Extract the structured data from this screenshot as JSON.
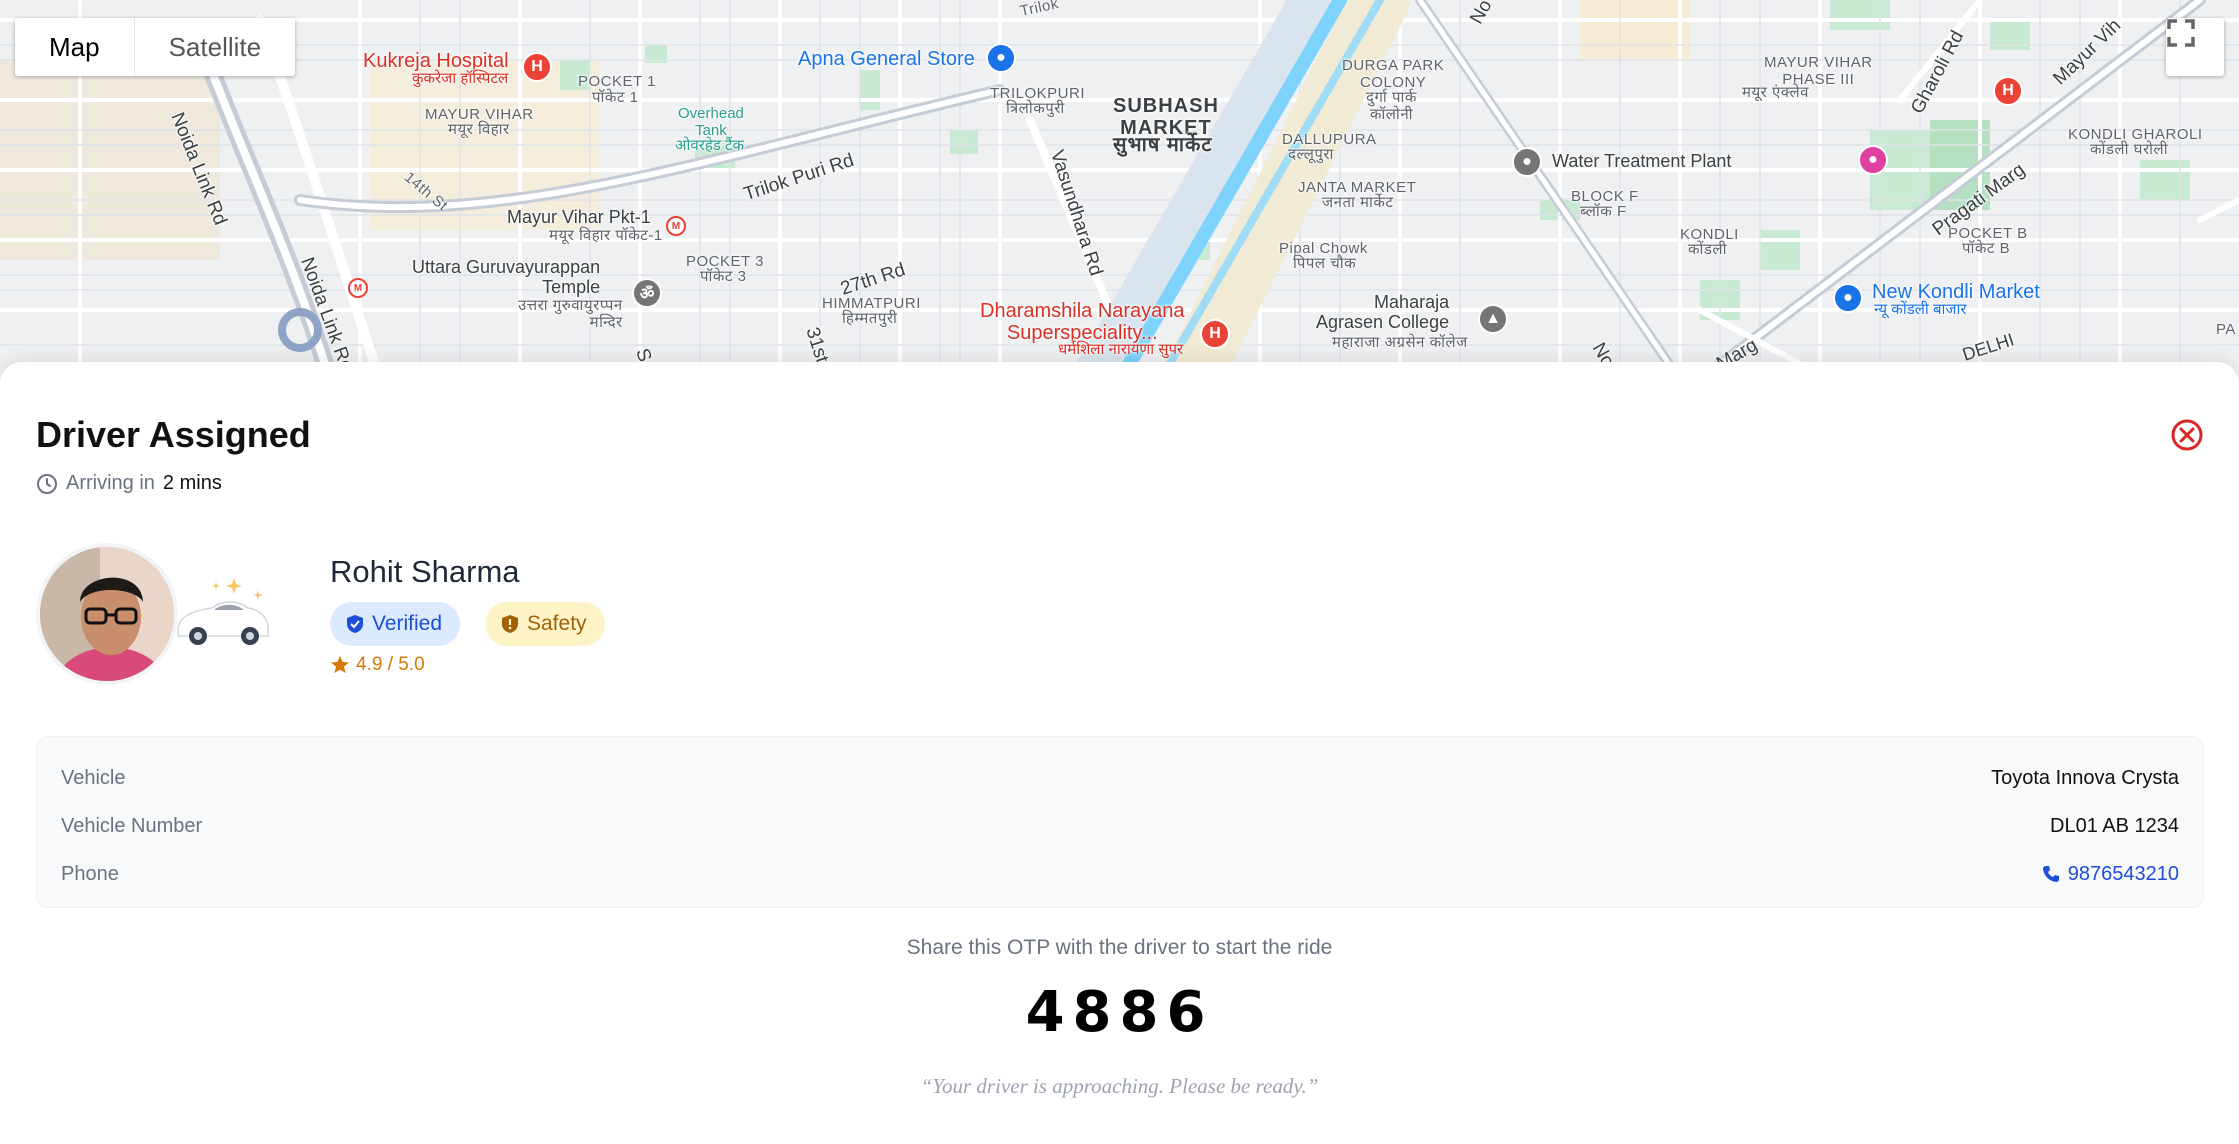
{
  "map": {
    "toggle": {
      "map_label": "Map",
      "satellite_label": "Satellite",
      "active": "Map"
    },
    "labels": {
      "kukreja": "Kukreja Hospital",
      "kukreja_hi": "कुकरेजा हॉस्पिटल",
      "mayur_vihar": "MAYUR VIHAR",
      "mayur_vihar_hi": "मयूर विहार",
      "pocket1": "POCKET 1",
      "pocket1_hi": "पॉकेट 1",
      "overhead_tank": "Overhead\nTank",
      "overhead_tank_hi": "ओवरहेड टैंक",
      "apna": "Apna General Store",
      "trilokpuri": "TRILOKPURI",
      "trilokpuri_hi": "त्रिलोकपुरी",
      "subhash_market": "SUBHASH\nMARKET",
      "subhash_market_hi": "सुभाष मार्केट",
      "durga_park": "DURGA PARK\nCOLONY",
      "durga_park_hi": "दुर्गा पार्क\nकॉलोनी",
      "dallupura": "DALLUPURA",
      "dallupura_hi": "दल्लूपुरा",
      "janta_market": "JANTA MARKET",
      "janta_market_hi": "जनता मार्केट",
      "water_plant": "Water Treatment Plant",
      "block_f": "BLOCK F",
      "block_f_hi": "ब्लॉक F",
      "mayur_vihar_3": "MAYUR VIHAR\nPHASE III",
      "mayur_vihar_3_hi": "मयूर एंक्लेव",
      "kondli": "KONDLI",
      "kondli_hi": "कोंडली",
      "kondli_gharoli": "KONDLI GHAROLI",
      "kondli_gharoli_hi": "कोंडली घरोली",
      "pocket_b": "POCKET B",
      "pocket_b_hi": "पॉकेट B",
      "new_kondli": "New Kondli Market",
      "new_kondli_hi": "न्यू कोंडली बाजार",
      "mv_pkt1": "Mayur Vihar Pkt-1",
      "mv_pkt1_hi": "मयूर विहार पॉकेट-1",
      "uttara": "Uttara Guruvayurappan\nTemple",
      "uttara_hi": "उत्तरा गुरुवायुरप्पन\nमन्दिर",
      "pocket3": "POCKET 3",
      "pocket3_hi": "पॉकेट 3",
      "himmatpuri": "HIMMATPURI",
      "himmatpuri_hi": "हिम्मतपुरी",
      "dharamshila": "Dharamshila Narayana\nSuperspeciality...",
      "dharamshila_hi": "धर्मशिला नारायणा सुपर",
      "pipal_chowk": "Pipal Chowk",
      "pipal_chowk_hi": "पिपल चौक",
      "maharaja": "Maharaja\nAgrasen College",
      "maharaja_hi": "महाराजा अग्रसेन कॉलेज",
      "delhi": "DELHI",
      "trilok_puri_rd": "Trilok Puri Rd",
      "noida_link_rd": "Noida Link Rd",
      "noida_link_rd2": "Noida Link Rd",
      "vasundhara_rd": "Vasundhara Rd",
      "pragati_marg": "Pragati Marg",
      "gharoli_rd": "Gharoli Rd",
      "mayur_vi_rd": "Mayur Vih",
      "rd_27th": "27th Rd",
      "rd_14th": "14th St",
      "marg": "Marg",
      "no": "No",
      "no2": "No",
      "rd_31st": "31st",
      "s_rd": "S",
      "trilok_top": "Trilok",
      "pa": "PA"
    }
  },
  "sheet": {
    "title": "Driver Assigned",
    "eta_prefix": "Arriving in",
    "eta_value": "2 mins",
    "driver": {
      "name": "Rohit Sharma",
      "verified_label": "Verified",
      "safety_label": "Safety",
      "rating": "4.9 / 5.0"
    },
    "details": [
      {
        "label": "Vehicle",
        "value": "Toyota Innova Crysta"
      },
      {
        "label": "Vehicle Number",
        "value": "DL01 AB 1234"
      },
      {
        "label": "Phone",
        "value": "9876543210"
      }
    ],
    "otp_label": "Share this OTP with the driver to start the ride",
    "otp": "4886",
    "quote": "“Your driver is approaching. Please be ready.”"
  },
  "colors": {
    "accent_blue": "#1d4ed8",
    "close_red": "#dc2626",
    "rating_amber": "#d97706",
    "canal": "#7dd3fc"
  }
}
